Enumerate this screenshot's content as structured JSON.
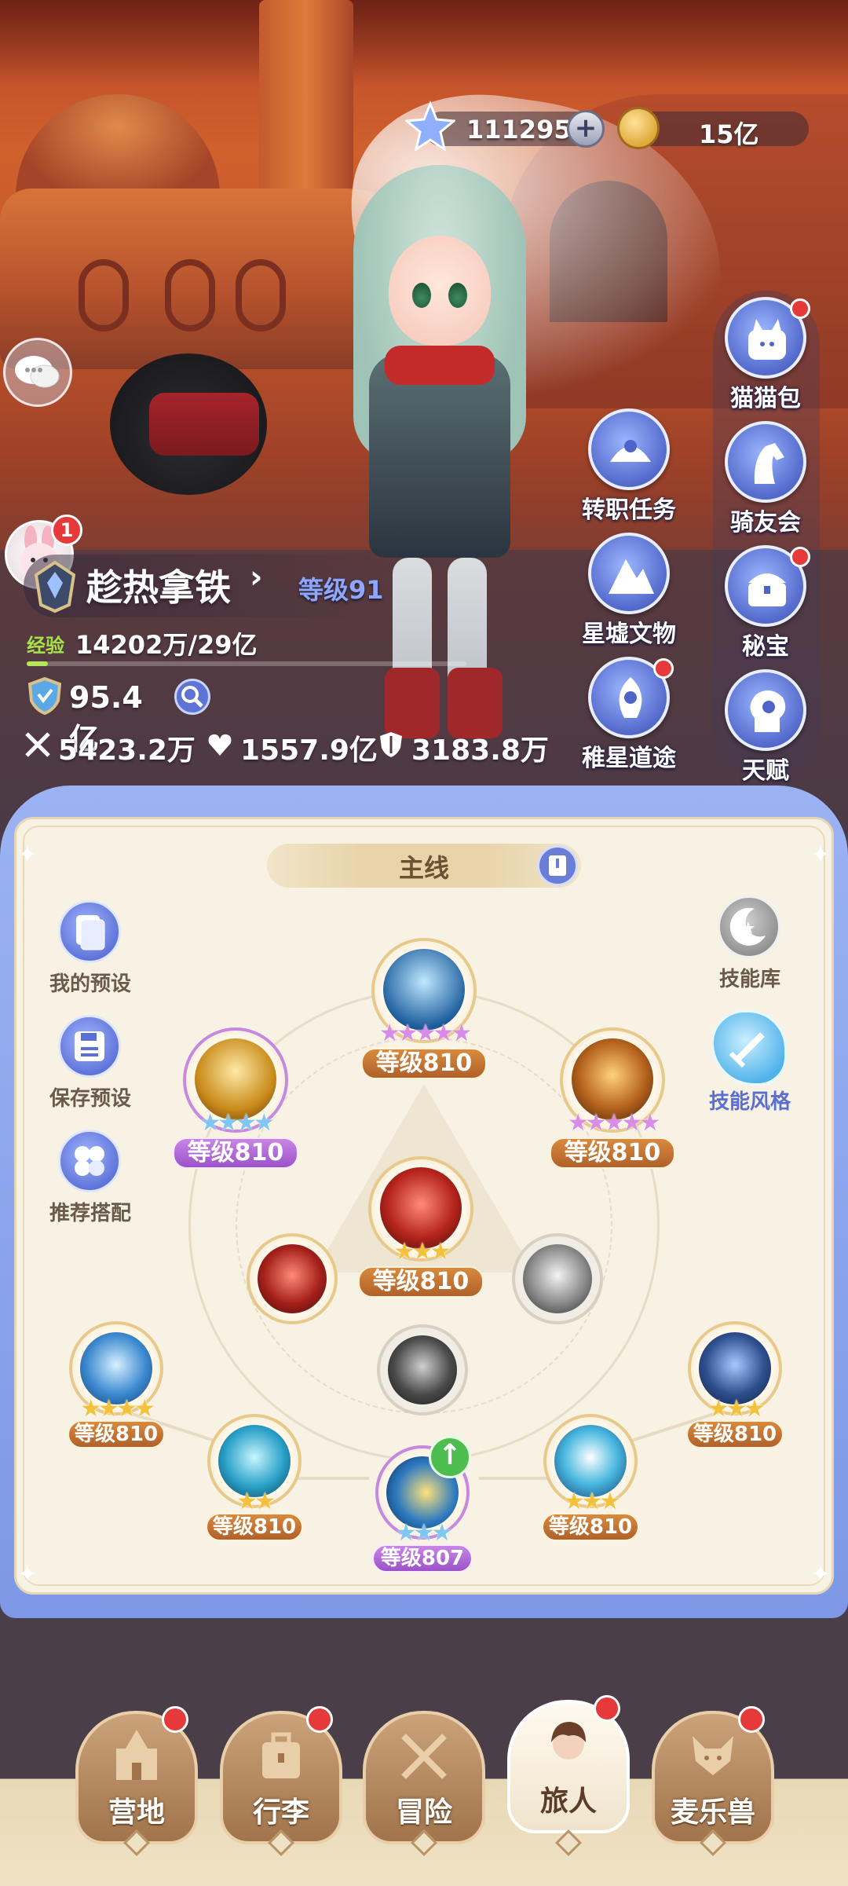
{
  "currency": {
    "stars": "111295",
    "plus": "+",
    "coins": "15亿"
  },
  "player": {
    "name": "趁热拿铁",
    "arrow": "›",
    "level": "等级91",
    "exp_tag": "经验",
    "exp": "14202万/29亿",
    "exp_progress": 0.049,
    "power": "95.4亿",
    "attack": "5423.2万",
    "hp": "1557.9亿",
    "defense": "3183.8万",
    "bunny_badge": "1"
  },
  "side_menu": {
    "left_col": [
      {
        "label": "转职任务",
        "icon": "job-change-icon",
        "dot": false
      },
      {
        "label": "星墟文物",
        "icon": "relic-icon",
        "dot": false
      },
      {
        "label": "稚星道途",
        "icon": "star-path-icon",
        "dot": true
      }
    ],
    "right_col": [
      {
        "label": "猫猫包",
        "icon": "cat-bag-icon",
        "dot": true
      },
      {
        "label": "骑友会",
        "icon": "horse-icon",
        "dot": false
      },
      {
        "label": "秘宝",
        "icon": "treasure-icon",
        "dot": true
      },
      {
        "label": "天赋",
        "icon": "talent-icon",
        "dot": false
      }
    ]
  },
  "panel": {
    "tab": "主线",
    "left_buttons": [
      {
        "label": "我的预设"
      },
      {
        "label": "保存预设"
      },
      {
        "label": "推荐搭配"
      }
    ],
    "right_buttons": [
      {
        "label": "技能库"
      },
      {
        "label": "技能风格"
      }
    ],
    "skills": [
      {
        "name": "top",
        "level": "等级810",
        "stars": "★★★★★",
        "star_color": "pink",
        "badge": "brown"
      },
      {
        "name": "upper-left",
        "level": "等级810",
        "stars": "★★★★",
        "star_color": "blue",
        "badge": "purple"
      },
      {
        "name": "upper-right",
        "level": "等级810",
        "stars": "★★★★★",
        "star_color": "pink",
        "badge": "brown"
      },
      {
        "name": "center",
        "level": "等级810",
        "stars": "★★★",
        "star_color": "gold",
        "badge": "brown"
      },
      {
        "name": "far-left",
        "level": "等级810",
        "stars": "★★★★",
        "star_color": "gold",
        "badge": "brown"
      },
      {
        "name": "far-right",
        "level": "等级810",
        "stars": "★★★",
        "star_color": "gold",
        "badge": "brown"
      },
      {
        "name": "lower-left",
        "level": "等级810",
        "stars": "★★",
        "star_color": "gold",
        "badge": "brown"
      },
      {
        "name": "bottom",
        "level": "等级807",
        "stars": "★★★",
        "star_color": "blue",
        "badge": "purple"
      },
      {
        "name": "lower-right",
        "level": "等级810",
        "stars": "★★★",
        "star_color": "gold",
        "badge": "brown"
      }
    ]
  },
  "nav": [
    {
      "label": "营地",
      "icon": "castle-icon",
      "dot": true,
      "active": false
    },
    {
      "label": "行李",
      "icon": "luggage-icon",
      "dot": true,
      "active": false
    },
    {
      "label": "冒险",
      "icon": "crossed-swords-icon",
      "dot": false,
      "active": false
    },
    {
      "label": "旅人",
      "icon": "traveler-icon",
      "dot": true,
      "active": true
    },
    {
      "label": "麦乐兽",
      "icon": "beast-icon",
      "dot": true,
      "active": false
    }
  ],
  "colors": {
    "accent_blue": "#5b70d6",
    "badge_red": "#e5393a",
    "level_brown": "#b0612a",
    "level_purple": "#9b52c8",
    "exp_green": "#a7e24a"
  }
}
